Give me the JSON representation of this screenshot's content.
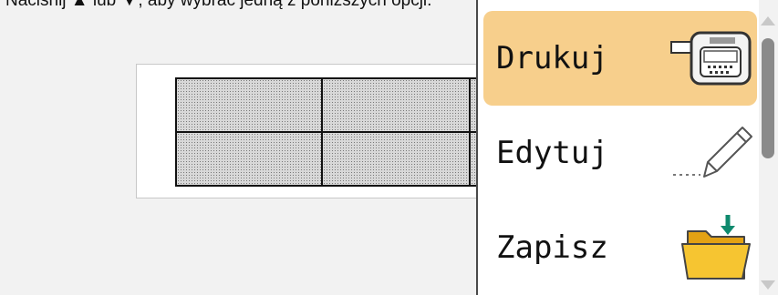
{
  "instruction": "Naciśnij ▲ lub ▼, aby wybrać jedną z poniższych opcji.",
  "menu": {
    "items": [
      {
        "label": "Drukuj",
        "icon": "printer-icon",
        "selected": true
      },
      {
        "label": "Edytuj",
        "icon": "pencil-icon",
        "selected": false
      },
      {
        "label": "Zapisz",
        "icon": "save-folder-icon",
        "selected": false
      }
    ],
    "selected_color": "#f7cf8c"
  }
}
